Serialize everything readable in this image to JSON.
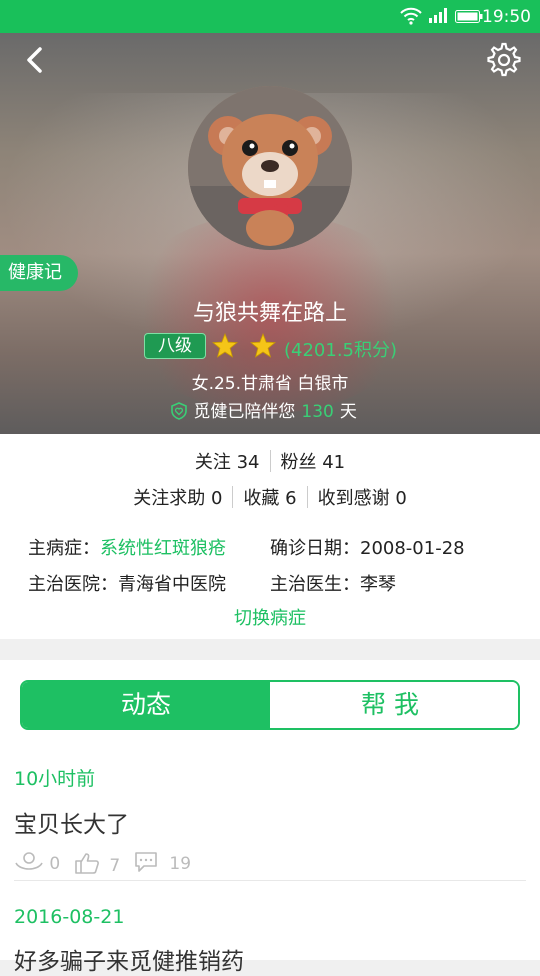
{
  "status_bar": {
    "time": "19:50"
  },
  "profile": {
    "health_tag": "健康记",
    "username": "与狼共舞在路上",
    "level": "八级",
    "points": "(4201.5积分)",
    "meta": "女.25.甘肃省 白银市",
    "companion_prefix": "觅健已陪伴您",
    "companion_days": "130",
    "companion_suffix": "天"
  },
  "stats": {
    "following": "关注 34",
    "fans": "粉丝 41",
    "help": "关注求助 0",
    "favorites": "收藏 6",
    "thanks": "收到感谢 0"
  },
  "medical": {
    "disease_label": "主病症：",
    "disease": "系统性红斑狼疮",
    "diagnosis_date_label": "确诊日期：",
    "diagnosis_date": "2008-01-28",
    "hospital_label": "主治医院：",
    "hospital": "青海省中医院",
    "doctor_label": "主治医生：",
    "doctor": "李琴",
    "switch_link": "切换病症"
  },
  "tabs": {
    "active": "动态",
    "inactive": "帮我"
  },
  "posts": [
    {
      "time": "10小时前",
      "title": "宝贝长大了",
      "hug_count": "0",
      "like_count": "7",
      "comment_count": "19"
    },
    {
      "time": "2016-08-21",
      "title": "好多骗子来觅健推销药"
    }
  ],
  "colors": {
    "brand_green": "#1ec063"
  }
}
